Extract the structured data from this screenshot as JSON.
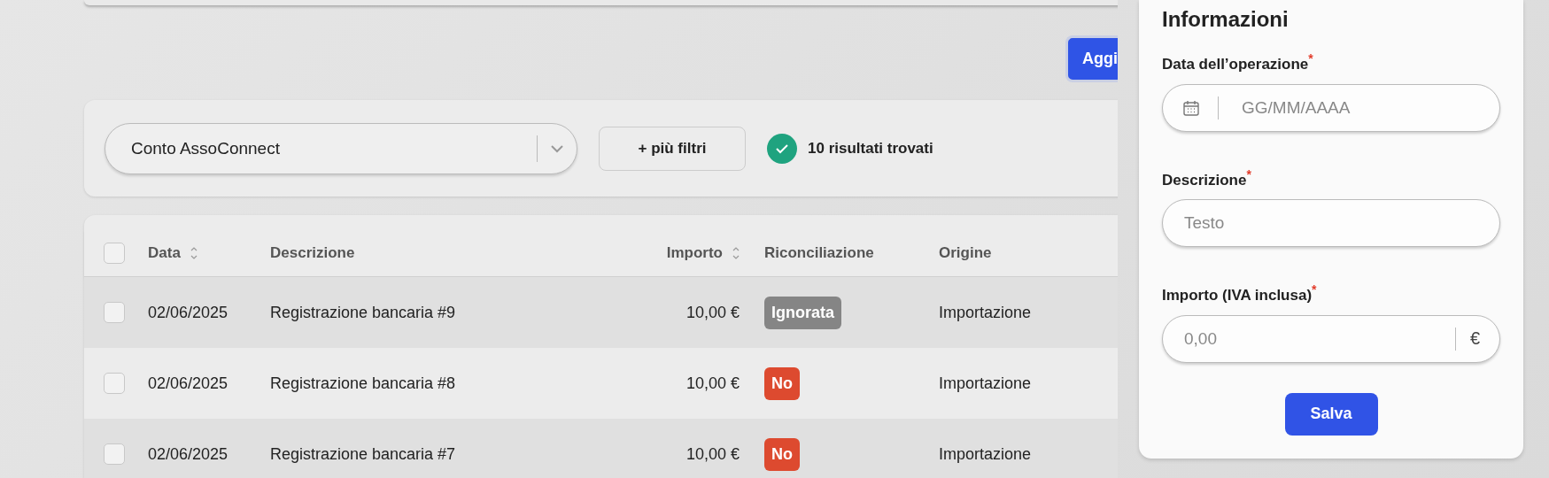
{
  "top_action": {
    "label": "Aggi"
  },
  "filters": {
    "account_select": {
      "value": "Conto AssoConnect"
    },
    "more_filters_button": "+ più filtri",
    "results": "10 risultati trovati"
  },
  "table": {
    "select_all": {
      "checked": false
    },
    "columns": [
      {
        "label": "Data",
        "sortable": true
      },
      {
        "label": "Descrizione",
        "sortable": false
      },
      {
        "label": "Importo",
        "sortable": true
      },
      {
        "label": "Riconciliazione",
        "sortable": false
      },
      {
        "label": "Origine",
        "sortable": false
      }
    ],
    "rows": [
      {
        "checked": false,
        "date": "02/06/2025",
        "description": "Registrazione bancaria #9",
        "amount": "10,00 €",
        "status": {
          "label": "Ignorata",
          "color": "#858585"
        },
        "origin": "Importazione"
      },
      {
        "checked": false,
        "date": "02/06/2025",
        "description": "Registrazione bancaria #8",
        "amount": "10,00 €",
        "status": {
          "label": "No",
          "color": "#dd4a2f"
        },
        "origin": "Importazione"
      },
      {
        "checked": false,
        "date": "02/06/2025",
        "description": "Registrazione bancaria #7",
        "amount": "10,00 €",
        "status": {
          "label": "No",
          "color": "#dd4a2f"
        },
        "origin": "Importazione"
      }
    ]
  },
  "panel": {
    "title": "Informazioni",
    "fields": [
      {
        "kind": "date",
        "label": "Data dell’operazione",
        "required_mark": "*",
        "placeholder": "GG/MM/AAAA"
      },
      {
        "kind": "text",
        "label": "Descrizione",
        "required_mark": "*",
        "placeholder": "Testo"
      },
      {
        "kind": "amount",
        "label": "Importo (IVA inclusa)",
        "required_mark": "*",
        "placeholder": "0,00",
        "suffix": "€"
      }
    ],
    "save_button": "Salva"
  }
}
